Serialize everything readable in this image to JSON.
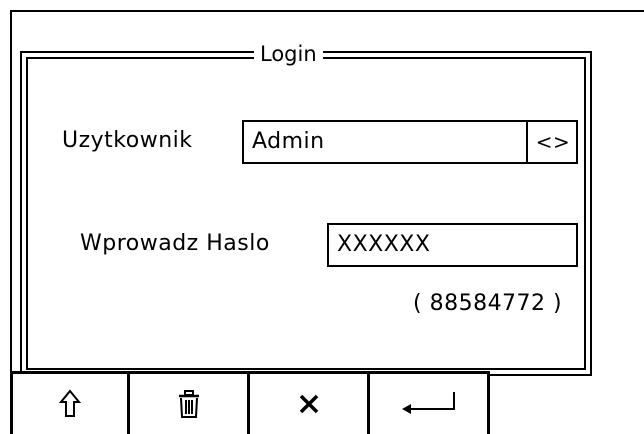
{
  "dialog": {
    "title": "Login"
  },
  "user": {
    "label": "Uzytkownik",
    "value": "Admin",
    "selector_symbol": "<>"
  },
  "password": {
    "label": "Wprowadz Haslo",
    "value": "XXXXXX",
    "code": "( 88584772 )"
  },
  "softkeys": [
    {
      "name": "up",
      "icon": "up-arrow-icon"
    },
    {
      "name": "delete",
      "icon": "trash-icon"
    },
    {
      "name": "cancel",
      "icon": "close-icon"
    },
    {
      "name": "enter",
      "icon": "enter-icon"
    }
  ]
}
